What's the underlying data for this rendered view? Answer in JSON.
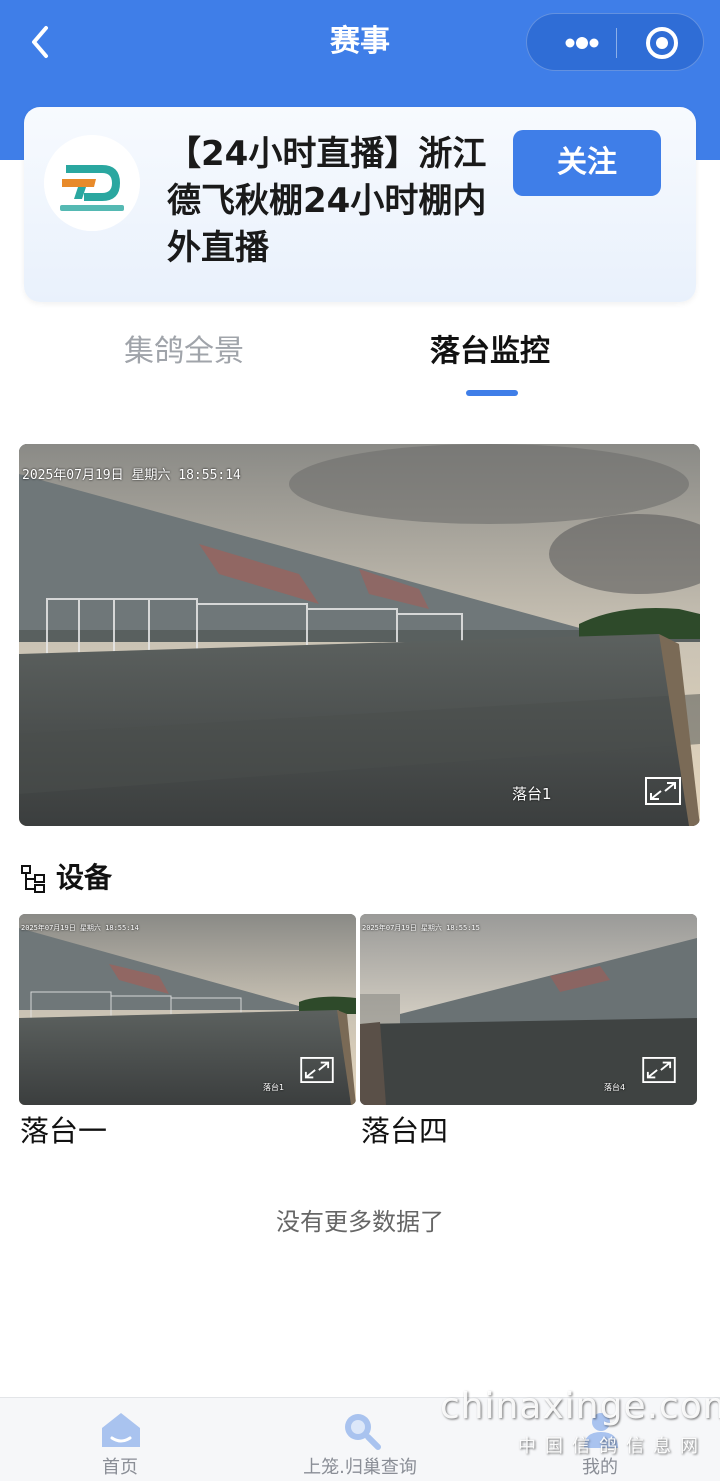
{
  "nav": {
    "title": "赛事"
  },
  "event_card": {
    "title": "【24小时直播】浙江德飞秋棚24小时棚内外直播",
    "follow_label": "关注"
  },
  "tabs": [
    {
      "label": "集鸽全景",
      "active": false
    },
    {
      "label": "落台监控",
      "active": true
    }
  ],
  "main_video": {
    "timestamp": "2025年07月19日 星期六 18:55:14",
    "camera_label": "落台1"
  },
  "devices": {
    "title": "设备",
    "items": [
      {
        "name": "落台一",
        "timestamp": "2025年07月19日 星期六 18:55:14",
        "camera_label": "落台1"
      },
      {
        "name": "落台四",
        "timestamp": "2025年07月19日 星期六 18:55:15",
        "camera_label": "落台4"
      }
    ]
  },
  "list_footer": "没有更多数据了",
  "tabbar": [
    {
      "label": "首页",
      "icon": "home-icon"
    },
    {
      "label": "上笼.归巢查询",
      "icon": "search-icon"
    },
    {
      "label": "我的",
      "icon": "user-icon"
    }
  ],
  "watermark": {
    "text": "chinaxinge.com",
    "subtext": "中国信鸽信息网"
  },
  "colors": {
    "primary": "#3f7ee8",
    "tab_inactive": "#a0a4aa"
  }
}
